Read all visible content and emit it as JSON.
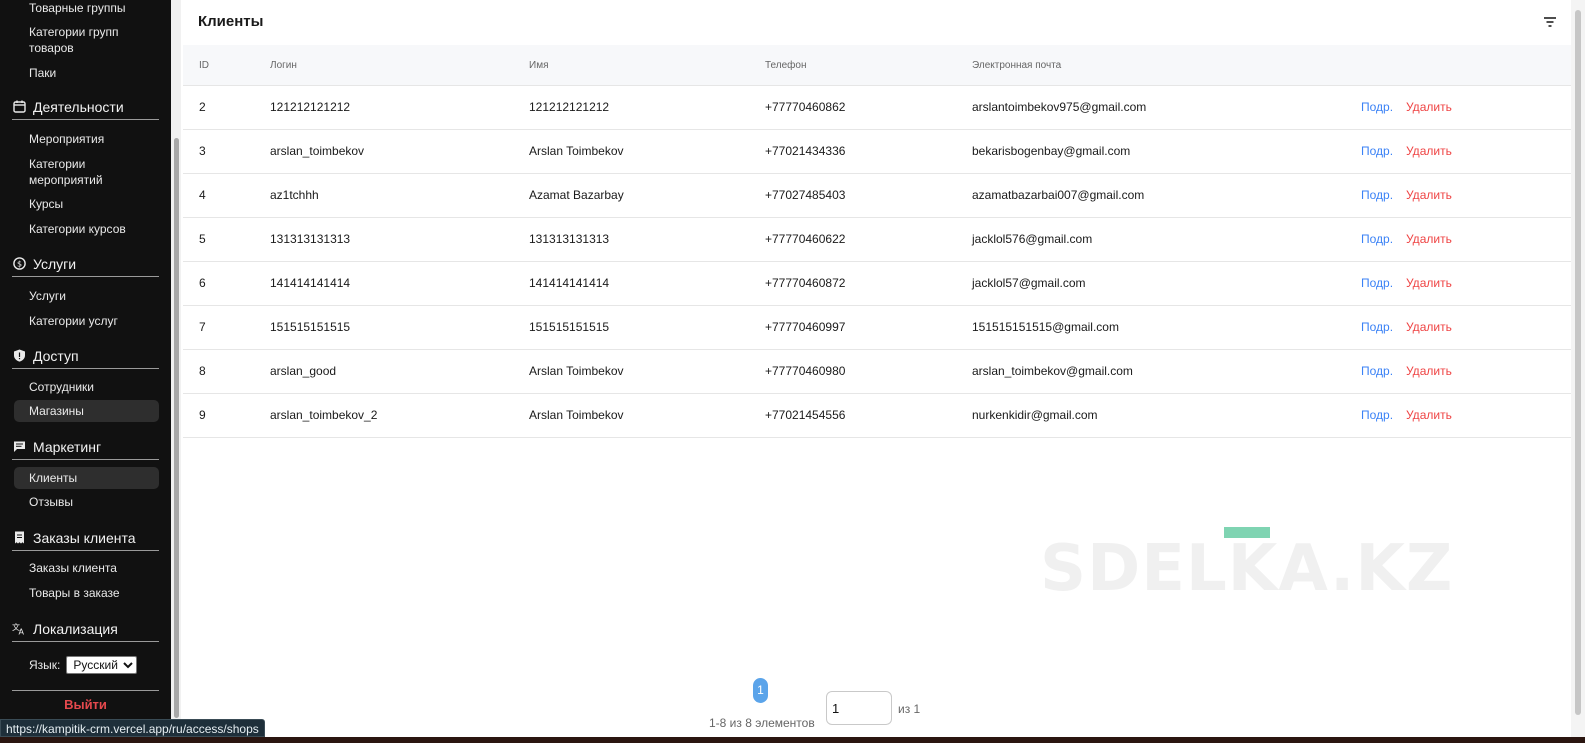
{
  "sidebar": {
    "items_top": [
      {
        "label": "Товарные группы"
      },
      {
        "label": "Категории групп товаров"
      },
      {
        "label": "Паки"
      }
    ],
    "sections": [
      {
        "title": "Деятельности",
        "icon": "calendar-icon",
        "items": [
          "Мероприятия",
          "Категории мероприятий",
          "Курсы",
          "Категории курсов"
        ]
      },
      {
        "title": "Услуги",
        "icon": "dollar-circle-icon",
        "items": [
          "Услуги",
          "Категории услуг"
        ]
      },
      {
        "title": "Доступ",
        "icon": "shield-icon",
        "items": [
          "Сотрудники",
          "Магазины"
        ]
      },
      {
        "title": "Маркетинг",
        "icon": "message-icon",
        "items": [
          "Клиенты",
          "Отзывы"
        ]
      },
      {
        "title": "Заказы клиента",
        "icon": "receipt-icon",
        "items": [
          "Заказы клиента",
          "Товары в заказе"
        ]
      },
      {
        "title": "Локализация",
        "icon": "translate-icon",
        "items": []
      }
    ],
    "language_label": "Язык:",
    "language_value": "Русский",
    "logout_label": "Выйти",
    "active_item": "Клиенты",
    "hover_item": "Магазины"
  },
  "main": {
    "title": "Клиенты",
    "filter_icon": "filter-icon",
    "columns": [
      "ID",
      "Логин",
      "Имя",
      "Телефон",
      "Электронная почта"
    ],
    "rows": [
      {
        "id": "2",
        "login": "121212121212",
        "name": "121212121212",
        "phone": "+77770460862",
        "email": "arslantoimbekov975@gmail.com",
        "detail": "Подр.",
        "delete": "Удалить"
      },
      {
        "id": "3",
        "login": "arslan_toimbekov",
        "name": "Arslan Toimbekov",
        "phone": "+77021434336",
        "email": "bekarisbogenbay@gmail.com",
        "detail": "Подр.",
        "delete": "Удалить"
      },
      {
        "id": "4",
        "login": "az1tchhh",
        "name": "Azamat Bazarbay",
        "phone": "+77027485403",
        "email": "azamatbazarbai007@gmail.com",
        "detail": "Подр.",
        "delete": "Удалить"
      },
      {
        "id": "5",
        "login": "131313131313",
        "name": "131313131313",
        "phone": "+77770460622",
        "email": "jacklol576@gmail.com",
        "detail": "Подр.",
        "delete": "Удалить"
      },
      {
        "id": "6",
        "login": "141414141414",
        "name": "141414141414",
        "phone": "+77770460872",
        "email": "jacklol57@gmail.com",
        "detail": "Подр.",
        "delete": "Удалить"
      },
      {
        "id": "7",
        "login": "151515151515",
        "name": "151515151515",
        "phone": "+77770460997",
        "email": "151515151515@gmail.com",
        "detail": "Подр.",
        "delete": "Удалить"
      },
      {
        "id": "8",
        "login": "arslan_good",
        "name": "Arslan Toimbekov",
        "phone": "+77770460980",
        "email": "arslan_toimbekov@gmail.com",
        "detail": "Подр.",
        "delete": "Удалить"
      },
      {
        "id": "9",
        "login": "arslan_toimbekov_2",
        "name": "Arslan Toimbekov",
        "phone": "+77021454556",
        "email": "nurkenkidir@gmail.com",
        "detail": "Подр.",
        "delete": "Удалить"
      }
    ],
    "watermark": "SDELKA.KZ",
    "pagination": {
      "current_page": "1",
      "range_text": "1-8 из 8 элементов",
      "jump_value": "1",
      "of_text": "из 1"
    }
  },
  "status_bar": {
    "url": "https://kampitik-crm.vercel.app/ru/access/shops"
  },
  "colors": {
    "sidebar_bg": "#111111",
    "link": "#3b82f6",
    "danger": "#ef4444",
    "page_btn": "#5ba4ea"
  }
}
